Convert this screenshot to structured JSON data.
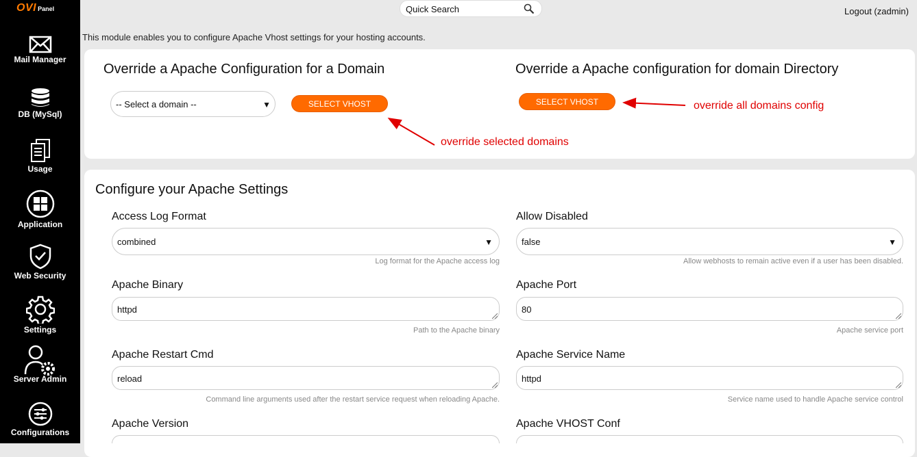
{
  "brand": {
    "name": "OVI",
    "suffix": "Panel"
  },
  "sidebar": {
    "items": [
      {
        "label": "Mail Manager",
        "icon": "mail-icon"
      },
      {
        "label": "DB (MySql)",
        "icon": "database-icon"
      },
      {
        "label": "Usage",
        "icon": "usage-icon"
      },
      {
        "label": "Application",
        "icon": "grid-icon"
      },
      {
        "label": "Web Security",
        "icon": "shield-icon"
      },
      {
        "label": "Settings",
        "icon": "gear-icon"
      },
      {
        "label": "Server Admin",
        "icon": "user-gear-icon"
      },
      {
        "label": "Configurations",
        "icon": "sliders-icon"
      }
    ]
  },
  "header": {
    "search_label": "Quick Search",
    "logout_label": "Logout (zadmin)"
  },
  "intro": "This module enables you to configure Apache Vhost settings for your hosting accounts.",
  "override": {
    "domain_title": "Override a Apache Configuration for a Domain",
    "directory_title": "Override a Apache configuration for domain Directory",
    "domain_select_value": "-- Select a domain --",
    "select_vhost_label": "SELECT VHOST",
    "select_vhost_label_2": "SELECT VHOST",
    "annotation_selected": "override selected domains",
    "annotation_all": "override all domains config"
  },
  "settings": {
    "title": "Configure your Apache Settings",
    "fields": {
      "access_log": {
        "label": "Access Log Format",
        "value": "combined",
        "help": "Log format for the Apache access log"
      },
      "allow_disabled": {
        "label": "Allow Disabled",
        "value": "false",
        "help": "Allow webhosts to remain active even if a user has been disabled."
      },
      "binary": {
        "label": "Apache Binary",
        "value": "httpd",
        "help": "Path to the Apache binary"
      },
      "port": {
        "label": "Apache Port",
        "value": "80",
        "help": "Apache service port"
      },
      "restart_cmd": {
        "label": "Apache Restart Cmd",
        "value": "reload",
        "help": "Command line arguments used after the restart service request when reloading Apache."
      },
      "service_name": {
        "label": "Apache Service Name",
        "value": "httpd",
        "help": "Service name used to handle Apache service control"
      },
      "version": {
        "label": "Apache Version"
      },
      "vhost_conf": {
        "label": "Apache VHOST Conf"
      }
    }
  },
  "colors": {
    "accent": "#ff6a00",
    "annotation": "#e00000",
    "sidebar": "#000000"
  }
}
